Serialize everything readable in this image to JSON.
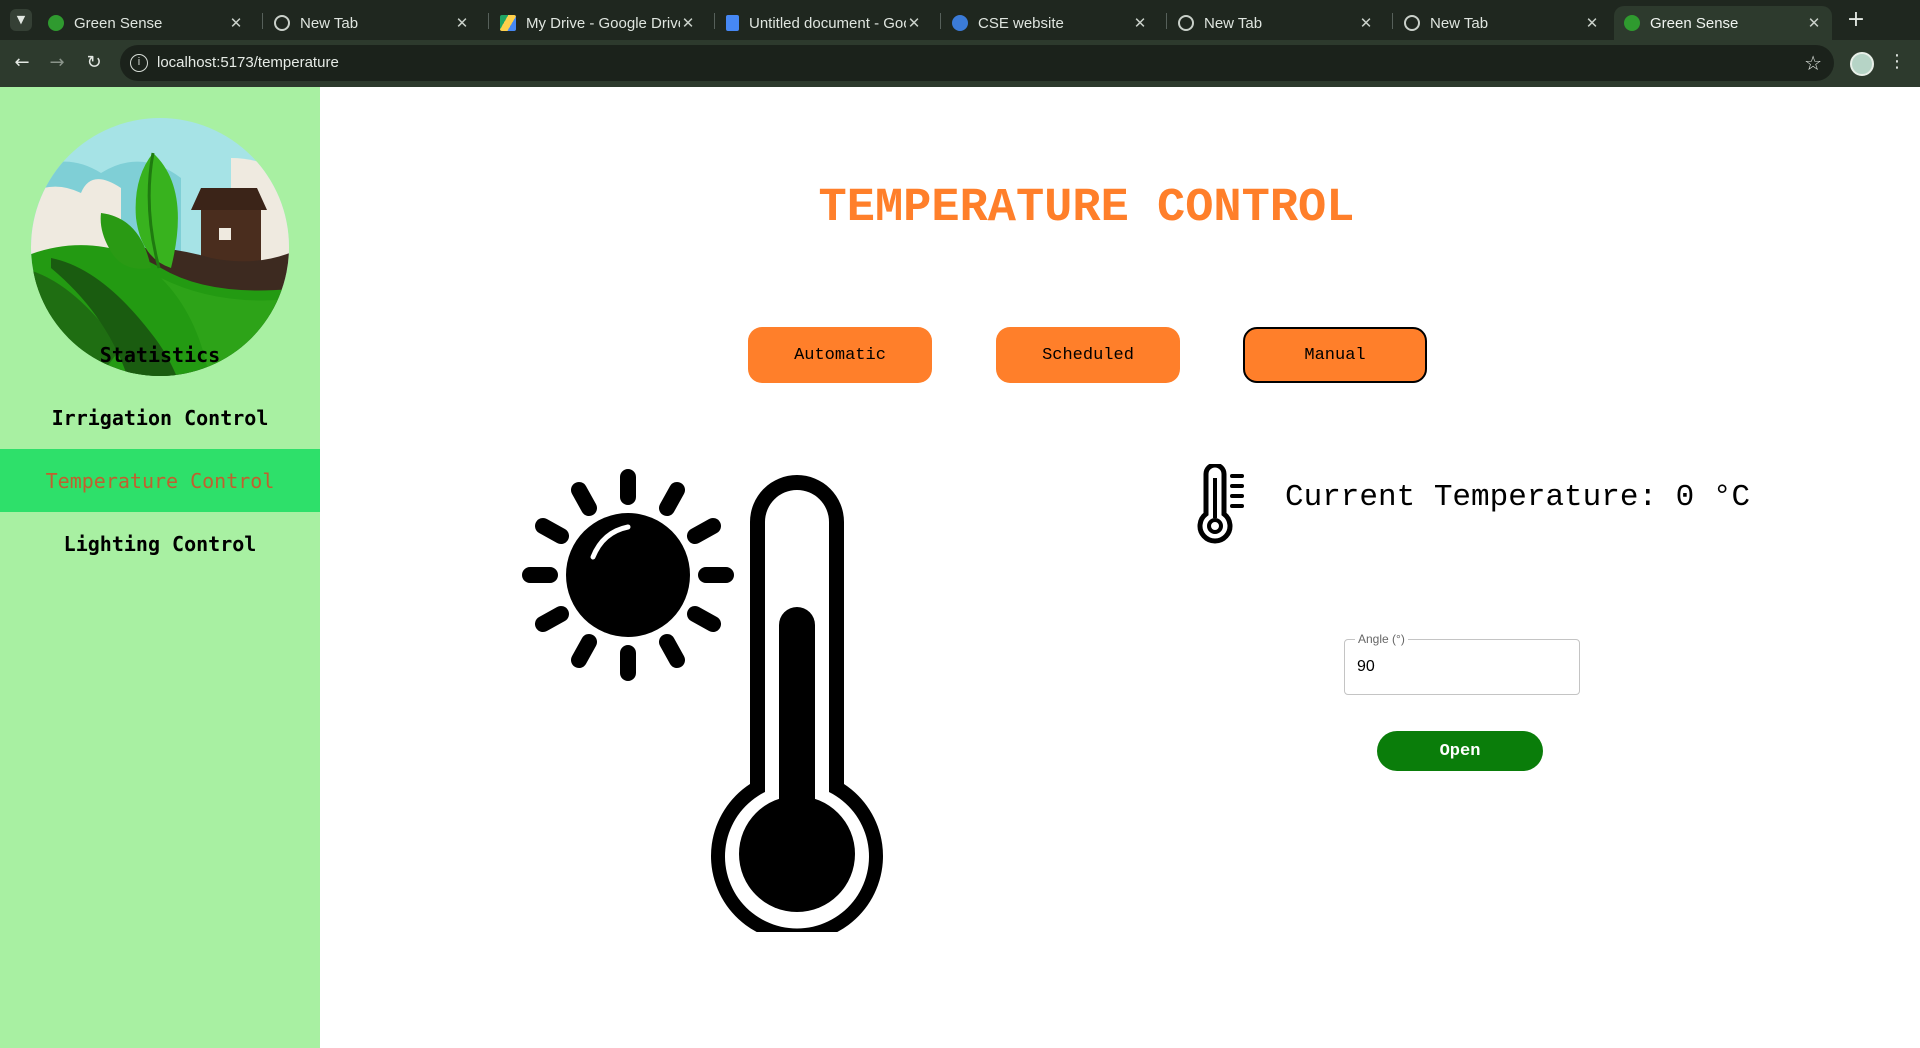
{
  "browser": {
    "tabs": [
      {
        "title": "Green Sense",
        "favicon": "green-sense-favicon"
      },
      {
        "title": "New Tab",
        "favicon": "chrome-icon"
      },
      {
        "title": "My Drive - Google Drive",
        "favicon": "google-drive-icon"
      },
      {
        "title": "Untitled document - Google Docs",
        "favicon": "google-docs-icon"
      },
      {
        "title": "CSE website",
        "favicon": "cse-website-icon"
      },
      {
        "title": "New Tab",
        "favicon": "chrome-icon"
      },
      {
        "title": "New Tab",
        "favicon": "chrome-icon"
      },
      {
        "title": "Green Sense",
        "favicon": "green-sense-favicon",
        "active": true
      }
    ],
    "url": "localhost:5173/temperature"
  },
  "sidebar": {
    "items": [
      {
        "label": "Statistics"
      },
      {
        "label": "Irrigation Control"
      },
      {
        "label": "Temperature Control",
        "active": true
      },
      {
        "label": "Lighting Control"
      }
    ]
  },
  "main": {
    "title": "TEMPERATURE CONTROL",
    "modes": [
      {
        "label": "Automatic"
      },
      {
        "label": "Scheduled"
      },
      {
        "label": "Manual",
        "selected": true
      }
    ],
    "current_temperature": "Current Temperature: 0 °C",
    "angle_field": {
      "label": "Angle (°)",
      "value": "90"
    },
    "open_button": "Open"
  },
  "colors": {
    "accent_orange": "#ff7f2a",
    "sidebar_bg": "#a8f0a2",
    "sidebar_active_bg": "#2ee06a",
    "sidebar_active_text": "#c0602f",
    "open_button_bg": "#0a7d0a"
  }
}
